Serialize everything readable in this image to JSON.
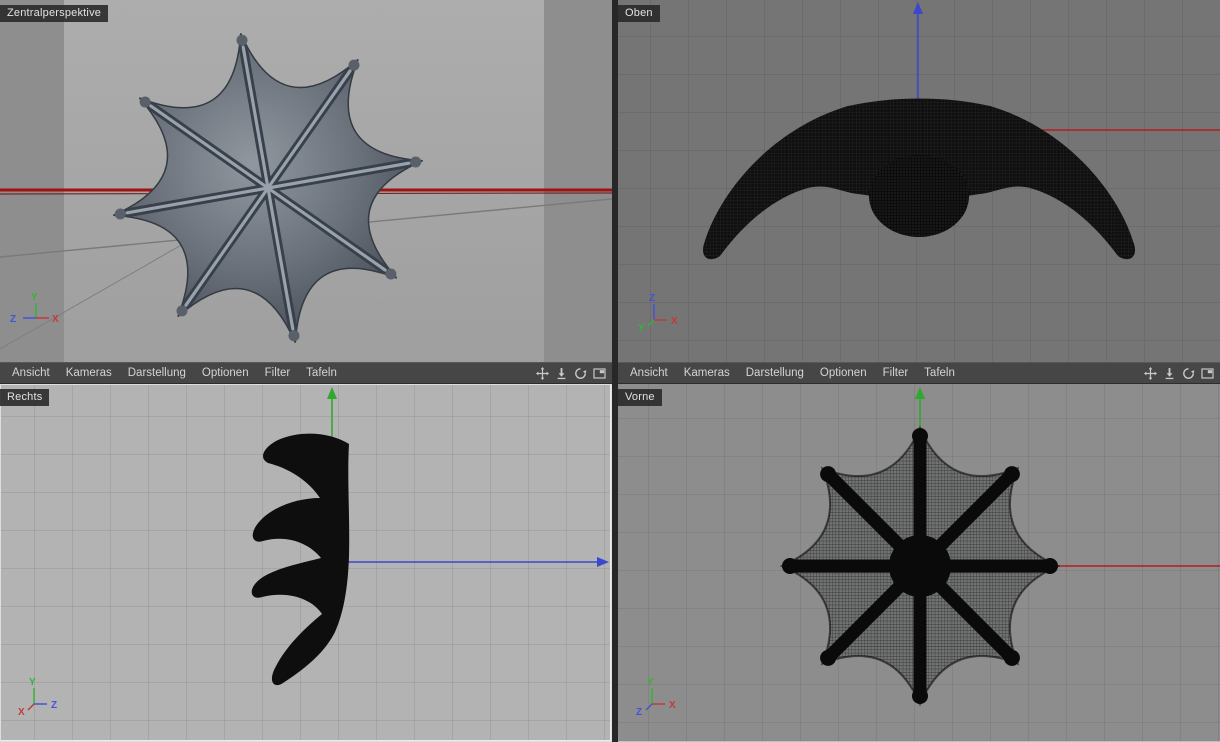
{
  "viewports": {
    "perspective": {
      "label": "Zentralperspektive"
    },
    "top": {
      "label": "Oben"
    },
    "right_view": {
      "label": "Rechts"
    },
    "front": {
      "label": "Vorne"
    }
  },
  "menu": {
    "items": [
      "Ansicht",
      "Kameras",
      "Darstellung",
      "Optionen",
      "Filter",
      "Tafeln"
    ]
  },
  "toolbar": {
    "icons": [
      "pan-icon",
      "dolly-icon",
      "rotate-icon",
      "maximize-viewport-icon"
    ]
  },
  "axis": {
    "x": "X",
    "y": "Y",
    "z": "Z"
  },
  "colors": {
    "axis_x": "#c23a3a",
    "axis_y": "#35b335",
    "axis_z": "#4553d6",
    "world_x_line": "#9e1414",
    "mesh_dark": "#0c0c0d"
  }
}
